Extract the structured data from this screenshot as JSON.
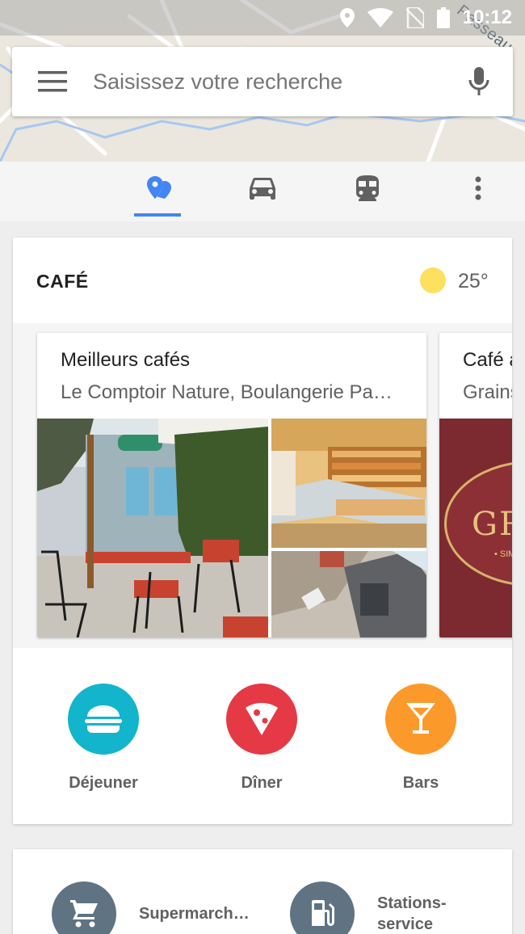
{
  "status_bar": {
    "time": "10:12"
  },
  "map": {
    "street_label": "Passeau"
  },
  "search": {
    "placeholder": "Saisissez votre recherche"
  },
  "tabs": [
    {
      "id": "explore",
      "icon": "explore-pin-icon",
      "active": true
    },
    {
      "id": "driving",
      "icon": "car-icon",
      "active": false
    },
    {
      "id": "transit",
      "icon": "train-icon",
      "active": false
    },
    {
      "id": "more",
      "icon": "more-vert-icon",
      "active": false
    }
  ],
  "card": {
    "title": "CAFÉ",
    "weather": {
      "icon": "sun-icon",
      "temp": "25°"
    },
    "collections": [
      {
        "title": "Meilleurs cafés",
        "subtitle": "Le Comptoir Nature, Boulangerie Pa…"
      },
      {
        "title": "Café à",
        "subtitle": "Grains",
        "logo_text": "GRA",
        "logo_sub": "• SIMPLE"
      }
    ],
    "categories": [
      {
        "label": "Déjeuner",
        "icon": "burger-icon",
        "color": "#12b5cb"
      },
      {
        "label": "Dîner",
        "icon": "pizza-icon",
        "color": "#e53945"
      },
      {
        "label": "Bars",
        "icon": "cocktail-icon",
        "color": "#fb9a2a"
      }
    ]
  },
  "services": [
    {
      "label": "Supermarch…",
      "icon": "cart-icon"
    },
    {
      "label_line1": "Stations-",
      "label_line2": "service",
      "icon": "gas-station-icon"
    }
  ],
  "colors": {
    "accent": "#4285f4",
    "service_icon_bg": "#5f7382",
    "sun": "#fde05e"
  }
}
